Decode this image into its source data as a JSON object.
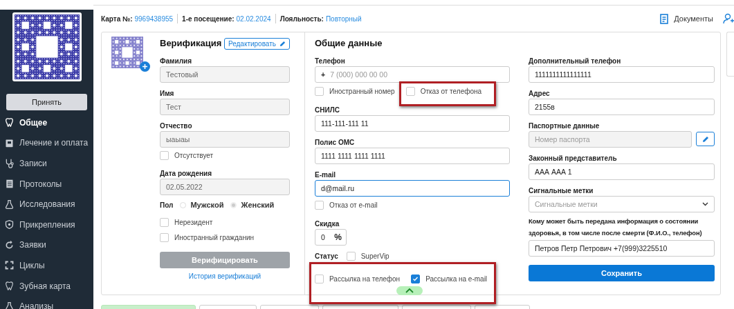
{
  "sidebar": {
    "accept_button": "Принять",
    "items": [
      {
        "label": "Общее",
        "selected": true
      },
      {
        "label": "Лечение и оплата",
        "selected": false
      },
      {
        "label": "Записи",
        "selected": false
      },
      {
        "label": "Протоколы",
        "selected": false
      },
      {
        "label": "Исследования",
        "selected": false
      },
      {
        "label": "Прикрепления",
        "selected": false
      },
      {
        "label": "Заявки",
        "selected": false
      },
      {
        "label": "Циклы",
        "selected": false
      },
      {
        "label": "Зубная карта",
        "selected": false
      },
      {
        "label": "Анализы",
        "selected": false
      }
    ]
  },
  "header": {
    "card_label": "Карта №:",
    "card_number": "9969438955",
    "first_visit_label": "1-е посещение:",
    "first_visit": "02.02.2024",
    "loyalty_label": "Лояльность:",
    "loyalty": "Повторный",
    "documents": "Документы"
  },
  "verification": {
    "title": "Верификация",
    "edit_button": "Редактировать",
    "surname": {
      "label": "Фамилия",
      "value": "Тестовый"
    },
    "name": {
      "label": "Имя",
      "value": "Тест"
    },
    "patronymic": {
      "label": "Отчество",
      "value": "ыаыаы"
    },
    "absent": {
      "label": "Отсутствует",
      "checked": false
    },
    "birth_date": {
      "label": "Дата рождения",
      "value": "02.05.2022"
    },
    "sex": {
      "label": "Пол",
      "options": [
        {
          "label": "Мужской",
          "selected": false
        },
        {
          "label": "Женский",
          "selected": true
        }
      ]
    },
    "checkboxes": [
      {
        "label": "Нерезидент",
        "checked": false
      },
      {
        "label": "Иностранный гражданин",
        "checked": false
      }
    ],
    "verify_button": {
      "label": "Верифицировать",
      "disabled": true
    },
    "history_link": "История верификаций"
  },
  "general": {
    "title": "Общие данные",
    "items": [
      {
        "kind": "phone",
        "label": "Телефон",
        "prefix": "+",
        "placeholder": "7 (000) 000 00 00"
      },
      {
        "kind": "checks",
        "items": [
          {
            "label": "Иностранный номер",
            "checked": false
          },
          {
            "label": "Отказ от телефона",
            "checked": false
          }
        ]
      },
      {
        "kind": "field",
        "label": "СНИЛС",
        "value": "111-111-111 11",
        "focused": false
      },
      {
        "kind": "field",
        "label": "Полис ОМС",
        "value": "1111 1111 1111 1111",
        "focused": false
      },
      {
        "kind": "field",
        "label": "E-mail",
        "value": "d@mail.ru",
        "focused": true
      },
      {
        "kind": "checks",
        "items": [
          {
            "label": "Отказ от e-mail",
            "checked": false
          }
        ]
      },
      {
        "kind": "discount",
        "label": "Скидка",
        "value": "0",
        "unit": "%"
      },
      {
        "kind": "status",
        "label": "Статус",
        "option": {
          "label": "SuperVip",
          "checked": false
        }
      },
      {
        "kind": "checks",
        "items": [
          {
            "label": "Рассылка на телефон",
            "checked": false
          },
          {
            "label": "Рассылка на e-mail",
            "checked": true
          }
        ]
      }
    ]
  },
  "extra": {
    "items": [
      {
        "kind": "field",
        "label": "Дополнительный телефон",
        "value": "1111111111111111"
      },
      {
        "kind": "field",
        "label": "Адрес",
        "value": "2155в"
      },
      {
        "kind": "passport",
        "label": "Паспортные данные",
        "placeholder": "Номер паспорта"
      },
      {
        "kind": "field",
        "label": "Законный представитель",
        "value": "ААА ААА 1"
      },
      {
        "kind": "select",
        "label": "Сигнальные метки",
        "placeholder": "Сигнальные метки"
      },
      {
        "kind": "field",
        "label": "Кому может быть передана информация о состоянии здоровья, в том числе после смерти (Ф.И.О., телефон)",
        "value": "Петров Петр Петрович +7(999)3225510"
      }
    ],
    "save_button": "Сохранить"
  },
  "bottom_tabs": [
    {
      "selected": true
    },
    {
      "selected": false
    },
    {
      "selected": false
    },
    {
      "selected": false
    },
    {
      "selected": false
    },
    {
      "selected": false
    }
  ]
}
